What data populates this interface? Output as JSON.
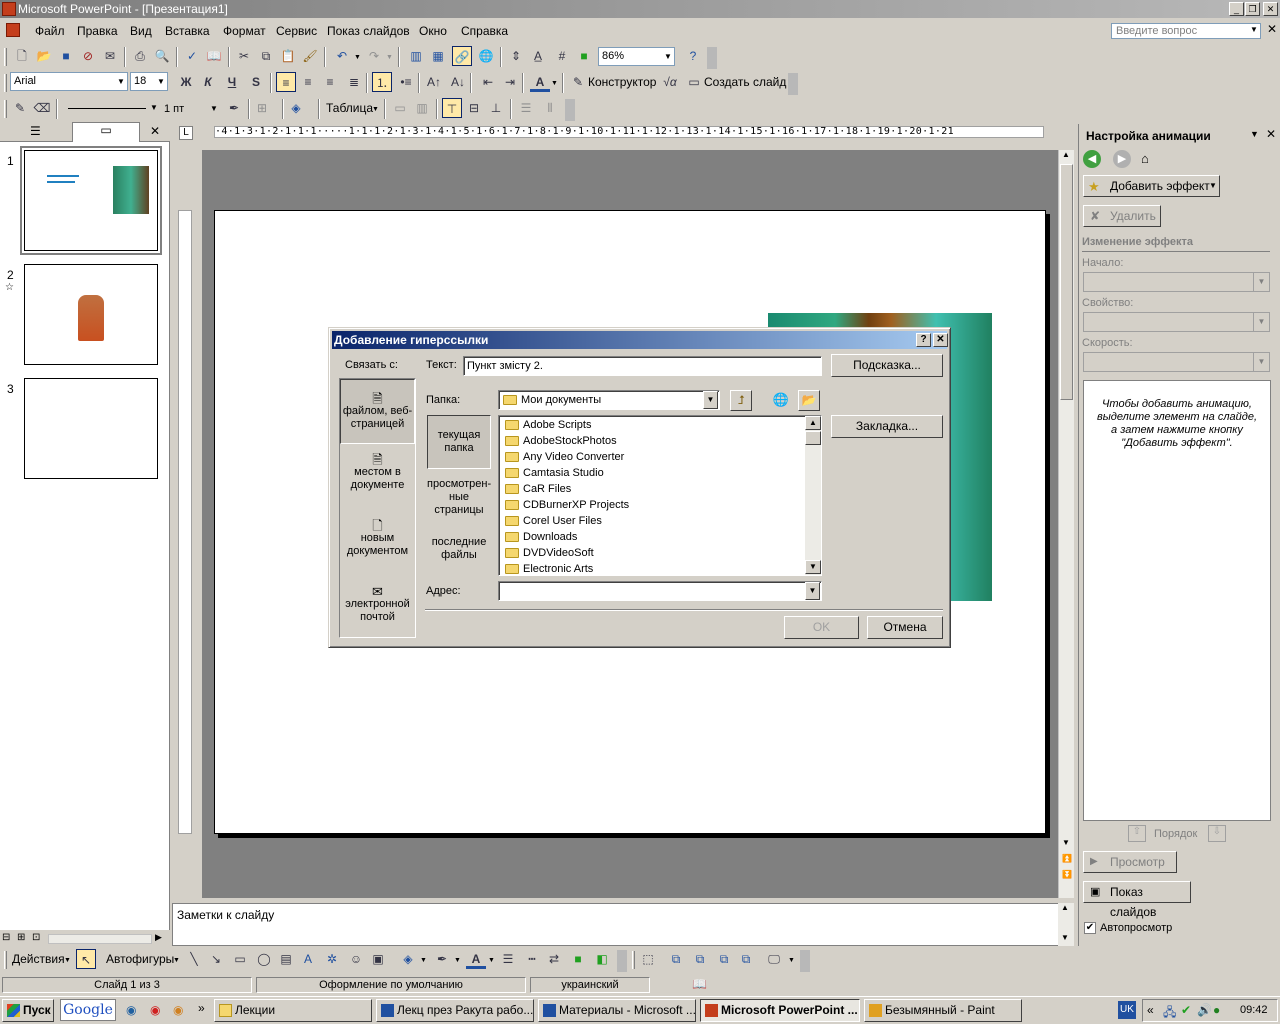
{
  "window": {
    "title": "Microsoft PowerPoint - [Презентация1]"
  },
  "menu": {
    "items": [
      "Файл",
      "Правка",
      "Вид",
      "Вставка",
      "Формат",
      "Сервис",
      "Показ слайдов",
      "Окно",
      "Справка"
    ],
    "help_placeholder": "Введите вопрос"
  },
  "toolbar": {
    "zoom": "86%",
    "font": "Arial",
    "size": "18",
    "bold": "Ж",
    "italic": "К",
    "underline": "Ч",
    "shadow": "S",
    "constructor_label": "Конструктор",
    "new_slide_label": "Создать слайд",
    "line_weight": "1 пт",
    "table_label": "Таблица"
  },
  "slides": [
    {
      "num": "1"
    },
    {
      "num": "2"
    },
    {
      "num": "3"
    }
  ],
  "notes": {
    "placeholder": "Заметки к слайду"
  },
  "taskpane": {
    "title": "Настройка анимации",
    "add_effect": "Добавить эффект",
    "delete": "Удалить",
    "change_effect": "Изменение эффекта",
    "start_label": "Начало:",
    "property_label": "Свойство:",
    "speed_label": "Скорость:",
    "hint": "Чтобы добавить анимацию, выделите элемент на слайде, а затем нажмите кнопку \"Добавить эффект\".",
    "order_label": "Порядок",
    "preview": "Просмотр",
    "slideshow": "Показ слайдов",
    "autopreview": "Автопросмотр"
  },
  "dialog": {
    "title": "Добавление гиперссылки",
    "link_to": "Связать с:",
    "text_label": "Текст:",
    "text_value": "Пункт змісту 2.",
    "hint_btn": "Подсказка...",
    "folder_label": "Папка:",
    "folder_value": "Мои документы",
    "bookmark_btn": "Закладка...",
    "address_label": "Адрес:",
    "ok": "OK",
    "cancel": "Отмена",
    "link_types": [
      "файлом, веб-страницей",
      "местом в документе",
      "новым документом",
      "электронной почтой"
    ],
    "nav": [
      "текущая папка",
      "просмотрен-ные страницы",
      "последние файлы"
    ],
    "files": [
      "Adobe Scripts",
      "AdobeStockPhotos",
      "Any Video Converter",
      "Camtasia Studio",
      "CaR Files",
      "CDBurnerXP Projects",
      "Corel User Files",
      "Downloads",
      "DVDVideoSoft",
      "Electronic Arts"
    ]
  },
  "drawing": {
    "actions": "Действия",
    "autoshapes": "Автофигуры"
  },
  "status": {
    "slide": "Слайд 1 из 3",
    "design": "Оформление по умолчанию",
    "lang": "украинский"
  },
  "taskbar": {
    "start": "Пуск",
    "google": "Google",
    "tasks": [
      "Лекции",
      "Лекц през Ракута рабо...",
      "Материалы - Microsoft ...",
      "Microsoft PowerPoint ...",
      "Безымянный - Paint"
    ],
    "lang": "UK",
    "clock": "09:42"
  }
}
